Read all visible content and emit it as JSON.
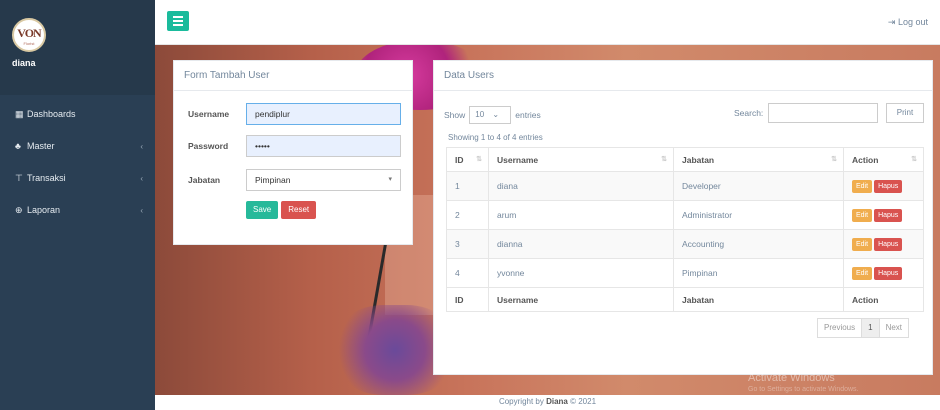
{
  "sidebar": {
    "logo_text": "VON",
    "logo_sub": "Florist",
    "user": "diana",
    "items": [
      {
        "icon": "dashboard-icon",
        "label": "Dashboards",
        "has_chevron": false
      },
      {
        "icon": "users-icon",
        "label": "Master",
        "has_chevron": true
      },
      {
        "icon": "cart-icon",
        "label": "Transaksi",
        "has_chevron": true
      },
      {
        "icon": "file-icon",
        "label": "Laporan",
        "has_chevron": true
      }
    ]
  },
  "topbar": {
    "logout_label": "Log out"
  },
  "form": {
    "title": "Form Tambah User",
    "username_label": "Username",
    "username_value": "pendiplur",
    "password_label": "Password",
    "password_value": "•••••",
    "jabatan_label": "Jabatan",
    "jabatan_value": "Pimpinan",
    "save_label": "Save",
    "reset_label": "Reset"
  },
  "users": {
    "title": "Data Users",
    "show_label": "Show",
    "length_value": "10",
    "entries_label": "entries",
    "search_label": "Search:",
    "print_label": "Print",
    "info": "Showing 1 to 4 of 4 entries",
    "columns": [
      "ID",
      "Username",
      "Jabatan",
      "Action"
    ],
    "rows": [
      {
        "id": "1",
        "username": "diana",
        "jabatan": "Developer"
      },
      {
        "id": "2",
        "username": "arum",
        "jabatan": "Administrator"
      },
      {
        "id": "3",
        "username": "dianna",
        "jabatan": "Accounting"
      },
      {
        "id": "4",
        "username": "yvonne",
        "jabatan": "Pimpinan"
      }
    ],
    "edit_label": "Edit",
    "delete_label": "Hapus",
    "prev_label": "Previous",
    "page_label": "1",
    "next_label": "Next"
  },
  "footer": {
    "prefix": "Copyright by ",
    "name": "Diana",
    "suffix": " © 2021"
  },
  "watermark": {
    "title": "Activate Windows",
    "sub": "Go to Settings to activate Windows."
  },
  "colors": {
    "sidebar": "#2a3f54",
    "accent": "#1abb9c",
    "danger": "#d9534f",
    "warning": "#f0ad4e"
  }
}
